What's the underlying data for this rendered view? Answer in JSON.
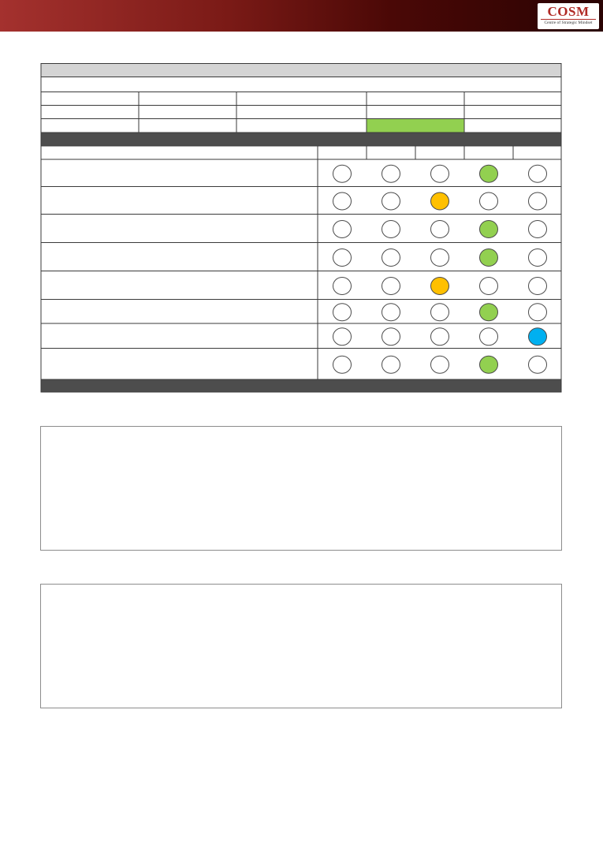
{
  "header": {
    "logo_text": "COSM",
    "logo_tagline": "Centre of Strategic Mindset"
  },
  "colors": {
    "banner_start": "#a4312e",
    "banner_end": "#2a0303",
    "table_header": "#d4d4d4",
    "dark_band": "#4d4d4d",
    "highlight_green": "#92d050",
    "amber": "#ffc000",
    "blue": "#00b0f0"
  },
  "rating_rows": [
    {
      "selected": 4,
      "color": "green"
    },
    {
      "selected": 3,
      "color": "amber"
    },
    {
      "selected": 4,
      "color": "green"
    },
    {
      "selected": 4,
      "color": "green"
    },
    {
      "selected": 3,
      "color": "amber"
    },
    {
      "selected": 4,
      "color": "green"
    },
    {
      "selected": 5,
      "color": "blue"
    },
    {
      "selected": 4,
      "color": "green"
    }
  ],
  "rating_scale_points": 5
}
